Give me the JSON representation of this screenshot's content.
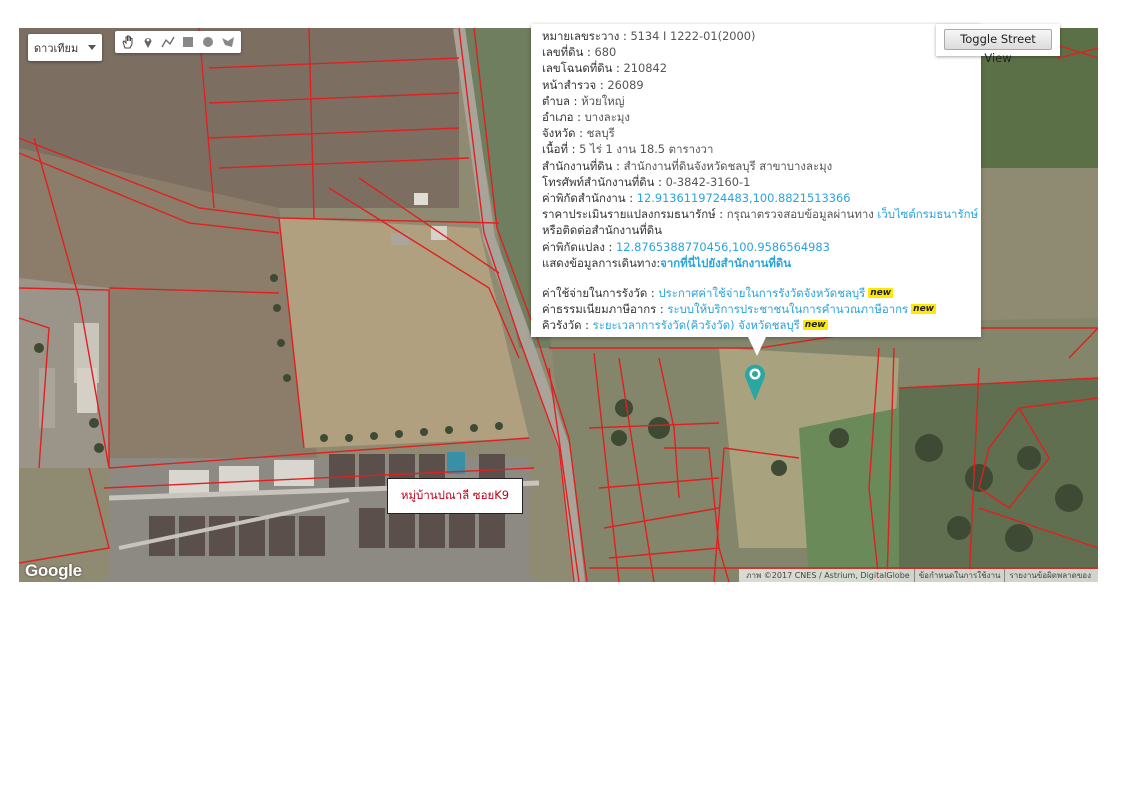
{
  "map": {
    "type_selector": {
      "selected": "ดาวเทียม"
    },
    "draw_tools": [
      "hand-icon",
      "marker-pin-icon",
      "polyline-icon",
      "rectangle-icon",
      "circle-icon",
      "polygon-icon"
    ],
    "toggle_street_view": "Toggle Street View",
    "village_label": "หมู่บ้านปณาลี ซอยK9",
    "google_logo": "Google",
    "attribution": {
      "imagery": "ภาพ ©2017 CNES / Astrium, DigitalGlobe",
      "terms": "ข้อกำหนดในการใช้งาน",
      "report": "รายงานข้อผิดพลาดของ"
    },
    "colors": {
      "parcel_line": "#e02020",
      "link": "#29a3dd",
      "new_badge": "#ffe900",
      "marker": "#2aa7a0"
    }
  },
  "parcel": {
    "rawang": {
      "label": "หมายเลขระวาง",
      "value": "5134 I 1222-01(2000)"
    },
    "land_no": {
      "label": "เลขที่ดิน",
      "value": "680"
    },
    "deed_no": {
      "label": "เลขโฉนดที่ดิน",
      "value": "210842"
    },
    "survey_page": {
      "label": "หน้าสำรวจ",
      "value": "26089"
    },
    "tambon": {
      "label": "ตำบล",
      "value": "ห้วยใหญ่"
    },
    "amphoe": {
      "label": "อำเภอ",
      "value": "บางละมุง"
    },
    "province": {
      "label": "จังหวัด",
      "value": "ชลบุรี"
    },
    "area": {
      "label": "เนื้อที่",
      "value": "5 ไร่ 1 งาน 18.5 ตารางวา"
    },
    "office": {
      "label": "สำนักงานที่ดิน",
      "value": "สำนักงานที่ดินจังหวัดชลบุรี สาขาบางละมุง"
    },
    "office_phone": {
      "label": "โทรศัพท์สำนักงานที่ดิน",
      "value": "0-3842-3160-1"
    },
    "office_coords": {
      "label": "ค่าพิกัดสำนักงาน",
      "value": "12.9136119724483,100.8821513366"
    },
    "appraisal": {
      "label": "ราคาประเมินรายแปลงกรมธนารักษ์",
      "text": "กรุณาตรวจสอบข้อมูลผ่านทาง",
      "link": "เว็บไซต์กรมธนารักษ์"
    },
    "contact_line": "หรือติดต่อสำนักงานที่ดิน",
    "parcel_coords": {
      "label": "ค่าพิกัดแปลง",
      "value": "12.8765388770456,100.9586564983"
    },
    "route": {
      "label": "แสดงข้อมูลการเดินทาง",
      "link": "จากที่นี่ไปยังสำนักงานที่ดิน"
    },
    "fee": {
      "label": "ค่าใช้จ่ายในการรังวัด",
      "link": "ประกาศค่าใช้จ่ายในการรังวัดจังหวัดชลบุรี",
      "badge": "new"
    },
    "tax": {
      "label": "ค่าธรรมเนียมภาษีอากร",
      "link": "ระบบให้บริการประชาชนในการคำนวณภาษีอากร",
      "badge": "new"
    },
    "queue": {
      "label": "คิวรังวัด",
      "link": "ระยะเวลาการรังวัด(คิวรังวัด) จังหวัดชลบุรี",
      "badge": "new"
    }
  }
}
